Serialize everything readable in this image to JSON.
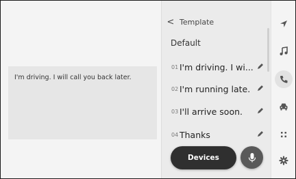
{
  "preview": {
    "message": "I'm driving. I will call you back later."
  },
  "panel": {
    "back_glyph": "<",
    "title": "Template",
    "section": "Default",
    "items": [
      {
        "num": "01",
        "text": "I'm driving. I wi..."
      },
      {
        "num": "02",
        "text": "I'm running late."
      },
      {
        "num": "03",
        "text": "I'll arrive soon."
      },
      {
        "num": "04",
        "text": "Thanks"
      }
    ]
  },
  "rail": {
    "icons": [
      "navigation-icon",
      "music-icon",
      "phone-icon",
      "car-icon",
      "apps-icon",
      "settings-icon"
    ],
    "active": "phone-icon"
  },
  "overlay": {
    "devices_label": "Devices"
  },
  "colors": {
    "pill": "#2f2f2f",
    "mic": "#595959",
    "panel": "#ebebeb"
  }
}
